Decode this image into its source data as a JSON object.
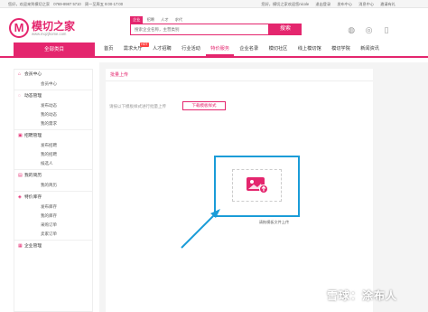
{
  "topbar": {
    "greeting": "您好，欢迎来到模切之家",
    "phone": "0769-8987 5710",
    "hours": "周一至周五 9:00-17:00",
    "welcome": "您好，模切之家欢迎您nicole",
    "logout": "退出登录",
    "publish": "发布中心",
    "messages": "消息中心",
    "mobile": "邀请有礼"
  },
  "logo": {
    "mark": "M",
    "name": "模切之家",
    "url": "www.mqzjhome.com"
  },
  "search": {
    "tabs": [
      "企业",
      "招聘",
      "人才",
      "求代"
    ],
    "active_tab": "企业",
    "placeholder": "搜索企业名称，主营类别",
    "button": "搜索"
  },
  "nav": {
    "all": "全部类目",
    "items": [
      {
        "label": "首页",
        "badge": ""
      },
      {
        "label": "需求大厅",
        "badge": "HOT"
      },
      {
        "label": "人才招聘",
        "badge": ""
      },
      {
        "label": "行业活动",
        "badge": ""
      },
      {
        "label": "特价服务",
        "badge": ""
      },
      {
        "label": "企业名录",
        "badge": ""
      },
      {
        "label": "模切社区",
        "badge": ""
      },
      {
        "label": "线上模切馆",
        "badge": ""
      },
      {
        "label": "模切学院",
        "badge": ""
      },
      {
        "label": "新闻资讯",
        "badge": ""
      }
    ],
    "active_index": 4
  },
  "sidebar": {
    "groups": [
      {
        "title": "会员中心",
        "icon": "home-icon",
        "items": [
          "会员中心"
        ]
      },
      {
        "title": "动态管理",
        "icon": "chat-icon",
        "items": [
          "发布动态",
          "我的动态",
          "我的需求"
        ]
      },
      {
        "title": "招聘管理",
        "icon": "briefcase-icon",
        "items": [
          "发布招聘",
          "我的招聘",
          "候选人"
        ]
      },
      {
        "title": "我的简历",
        "icon": "doc-icon",
        "items": [
          "我的简历"
        ]
      },
      {
        "title": "特价库存",
        "icon": "tag-icon",
        "items": [
          "发布库存",
          "我的库存",
          "采购订单",
          "卖家订单"
        ]
      },
      {
        "title": "企业管理",
        "icon": "building-icon",
        "items": []
      }
    ]
  },
  "panel": {
    "title": "批量上传",
    "hint": "请按以下模板样式进行批量上传",
    "download": "下载模板样式",
    "upload_label": "请拖模板文件上传"
  },
  "watermark": "雪球：涂布人",
  "colors": {
    "brand": "#e4266e",
    "highlight": "#1a9cd8"
  }
}
